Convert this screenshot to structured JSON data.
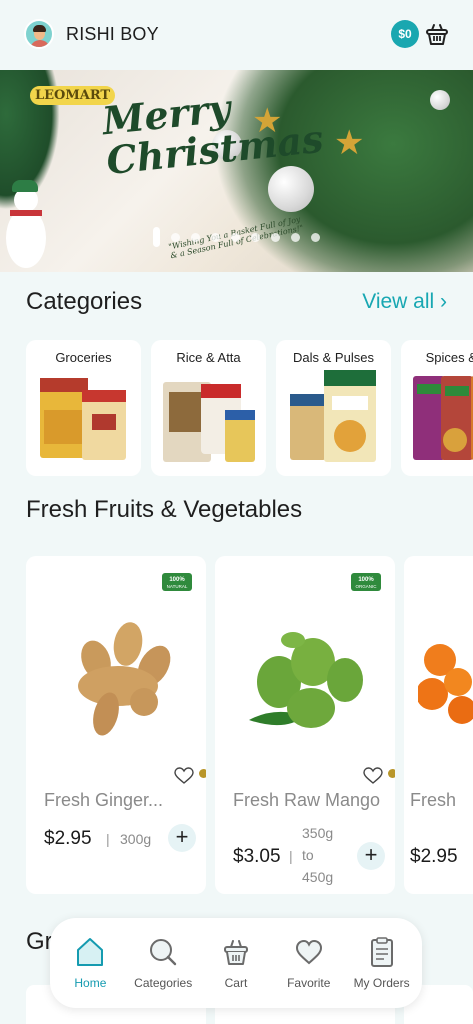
{
  "header": {
    "user_name": "RISHI BOY",
    "wallet_balance": "$0"
  },
  "banner": {
    "logo": "LEOMART",
    "title_line1": "Merry",
    "title_line2": "Christmas",
    "tagline": "\"Wishing You a Basket Full of Joy & a Season Full of Celebrations!\"",
    "slide_count": 9,
    "active_slide": 1
  },
  "categories": {
    "title": "Categories",
    "view_all": "View  all ›",
    "items": [
      {
        "label": "Groceries"
      },
      {
        "label": "Rice & Atta"
      },
      {
        "label": "Dals & Pulses"
      },
      {
        "label": "Spices & M"
      }
    ]
  },
  "fresh": {
    "title": "Fresh Fruits & Vegetables",
    "products": [
      {
        "name": "Fresh Ginger...",
        "price": "$2.95",
        "sep": "|",
        "weight": "300g",
        "badge": "100% NATURAL"
      },
      {
        "name": "Fresh Raw Mango",
        "price": "$3.05",
        "sep": "|",
        "weight_line1": "350g",
        "weight_line2": "to",
        "weight_line3": "450g",
        "badge": "100% ORGANIC"
      },
      {
        "name": "Fresh",
        "price": "$2.95"
      }
    ]
  },
  "next_section": {
    "title_peek": "Gr"
  },
  "bottom_nav": {
    "items": [
      {
        "label": "Home",
        "active": true
      },
      {
        "label": "Categories"
      },
      {
        "label": "Cart"
      },
      {
        "label": "Favorite"
      },
      {
        "label": "My Orders"
      }
    ]
  },
  "colors": {
    "accent": "#18a7b2",
    "background": "#f1f8f8",
    "card": "#ffffff"
  }
}
